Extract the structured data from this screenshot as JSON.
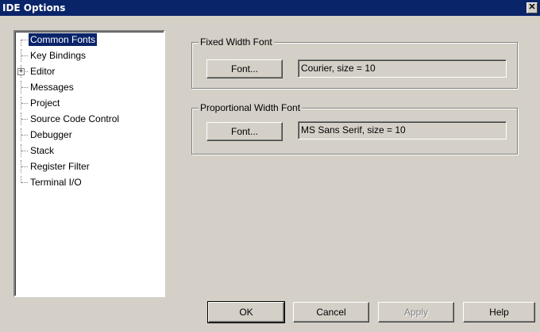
{
  "window": {
    "title": "IDE Options",
    "close_glyph": "✕"
  },
  "tree": {
    "items": [
      {
        "label": "Common Fonts",
        "selected": true
      },
      {
        "label": "Key Bindings"
      },
      {
        "label": "Editor",
        "expander": "+"
      },
      {
        "label": "Messages"
      },
      {
        "label": "Project"
      },
      {
        "label": "Source Code Control"
      },
      {
        "label": "Debugger"
      },
      {
        "label": "Stack"
      },
      {
        "label": "Register Filter"
      },
      {
        "label": "Terminal I/O"
      }
    ]
  },
  "fixed_font": {
    "group_title": "Fixed Width Font",
    "button_label": "Font...",
    "value": "Courier, size = 10"
  },
  "proportional_font": {
    "group_title": "Proportional Width Font",
    "button_label": "Font...",
    "value": "MS Sans Serif, size = 10"
  },
  "buttons": {
    "ok": "OK",
    "cancel": "Cancel",
    "apply": "Apply",
    "help": "Help"
  }
}
